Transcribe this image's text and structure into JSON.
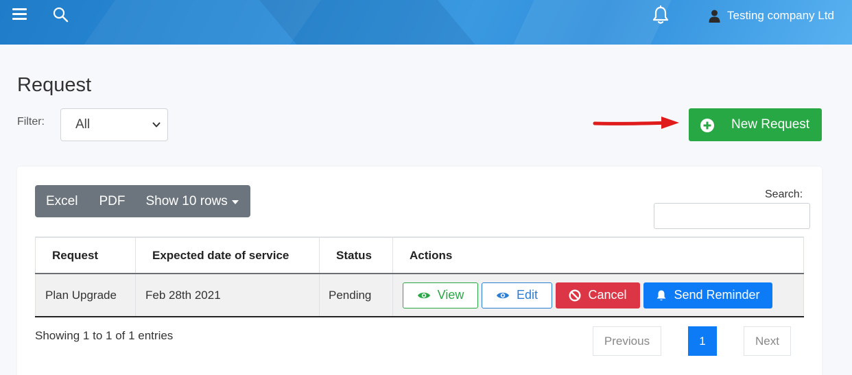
{
  "header": {
    "user_name": "Testing company Ltd"
  },
  "page": {
    "title": "Request",
    "filter_label": "Filter:",
    "filter_value": "All",
    "new_request_label": "New Request"
  },
  "toolbar": {
    "excel_label": "Excel",
    "pdf_label": "PDF",
    "rows_label": "Show 10 rows",
    "search_label": "Search:",
    "search_value": ""
  },
  "table": {
    "columns": [
      "Request",
      "Expected date of service",
      "Status",
      "Actions"
    ],
    "rows": [
      {
        "request": "Plan Upgrade",
        "date": "Feb 28th 2021",
        "status": "Pending",
        "actions": {
          "view": "View",
          "edit": "Edit",
          "cancel": "Cancel",
          "remind": "Send Reminder"
        }
      }
    ]
  },
  "footer": {
    "showing": "Showing 1 to 1 of 1 entries",
    "prev_label": "Previous",
    "current_page": "1",
    "next_label": "Next"
  },
  "colors": {
    "success": "#28a745",
    "primary": "#0d7bf5",
    "danger": "#dc3545",
    "secondary": "#6c757d",
    "annotation_arrow": "#e01b1b"
  }
}
